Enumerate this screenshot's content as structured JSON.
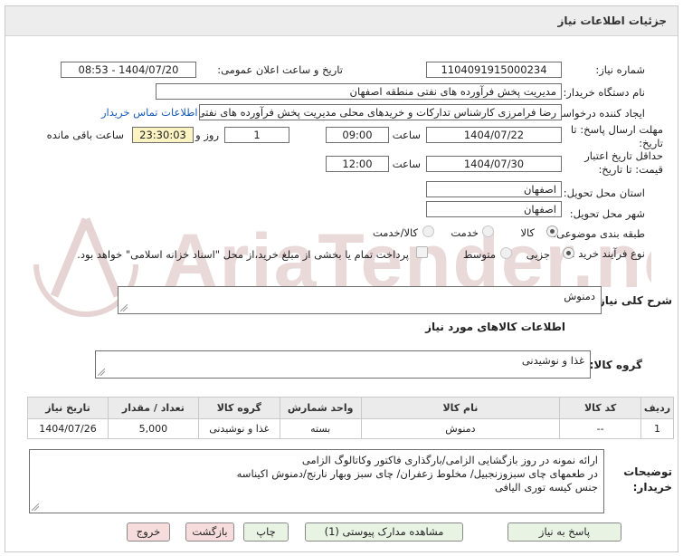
{
  "window": {
    "title": "جزئیات اطلاعات نیاز"
  },
  "fields": {
    "need_number_label": "شماره نیاز:",
    "need_number": "1104091915000234",
    "announce_label": "تاریخ و ساعت اعلان عمومی:",
    "announce_value": "1404/07/20 - 08:53",
    "buyer_org_label": "نام دستگاه خریدار:",
    "buyer_org": "مدیریت پخش فرآورده های نفتی منطقه اصفهان",
    "requester_label": "ایجاد کننده درخواست:",
    "requester": "رضا فرامرزی کارشناس تدارکات و خریدهای محلی مدیریت پخش فرآورده های نفتی منطقه اصفهان",
    "buyer_contact_link": "اطلاعات تماس خریدار",
    "deadline_label": "مهلت ارسال پاسخ: تا تاریخ:",
    "deadline_date": "1404/07/22",
    "time_label": "ساعت",
    "deadline_time": "09:00",
    "days_value": "1",
    "days_label": "روز و",
    "remaining_time": "23:30:03",
    "remaining_label": "ساعت باقی مانده",
    "validity_label": "حداقل تاریخ اعتبار قیمت: تا تاریخ:",
    "validity_date": "1404/07/30",
    "validity_time": "12:00",
    "province_label": "استان محل تحویل:",
    "province": "اصفهان",
    "city_label": "شهر محل تحویل:",
    "city": "اصفهان",
    "category_label": "طبقه بندی موضوعی:",
    "category_options": [
      "کالا",
      "خدمت",
      "کالا/خدمت"
    ],
    "process_label": "نوع فرآیند خرید :",
    "process_options": [
      "جزیی",
      "متوسط"
    ],
    "payment_note": "پرداخت تمام یا بخشی از مبلغ خرید،از محل \"اسناد خزانه اسلامی\" خواهد بود."
  },
  "need_summary": {
    "label": "شرح کلی نیاز:",
    "value": "دمنوش"
  },
  "goods_section": {
    "title": "اطلاعات کالاهای مورد نیاز",
    "group_label": "گروه کالا:",
    "group_value": "غذا و نوشیدنی"
  },
  "table": {
    "headers": [
      "ردیف",
      "کد کالا",
      "نام کالا",
      "واحد شمارش",
      "گروه کالا",
      "تعداد / مقدار",
      "تاریخ نیاز"
    ],
    "rows": [
      [
        "1",
        "--",
        "دمنوش",
        "بسته",
        "غذا و نوشیدنی",
        "5,000",
        "1404/07/26"
      ]
    ]
  },
  "buyer_notes": {
    "label": "توضیحات خریدار:",
    "lines": [
      "ارائه نمونه در روز بازگشایی الزامی/بارگذاری فاکتور وکاتالوگ الزامی",
      "در طعمهای چای سبزوزنجبیل/ مخلوط زعفران/ چای سبز وبهار نارنج/دمنوش اکیناسه",
      "جنس کیسه توری الیافی"
    ]
  },
  "buttons": {
    "reply": "پاسخ به نیاز",
    "view_docs": "مشاهده مدارک پیوستی (1)",
    "print": "چاپ",
    "back": "بازگشت",
    "exit": "خروج"
  },
  "watermark": {
    "text": "AriaTender.neT"
  },
  "colors": {
    "header_bg": "#ededed",
    "link": "#1a5bb8",
    "yellow_box": "#fbf3c2",
    "green_button": "#e9f3e4",
    "red_button": "#f6dcdc",
    "watermark": "#d9c4c4"
  }
}
